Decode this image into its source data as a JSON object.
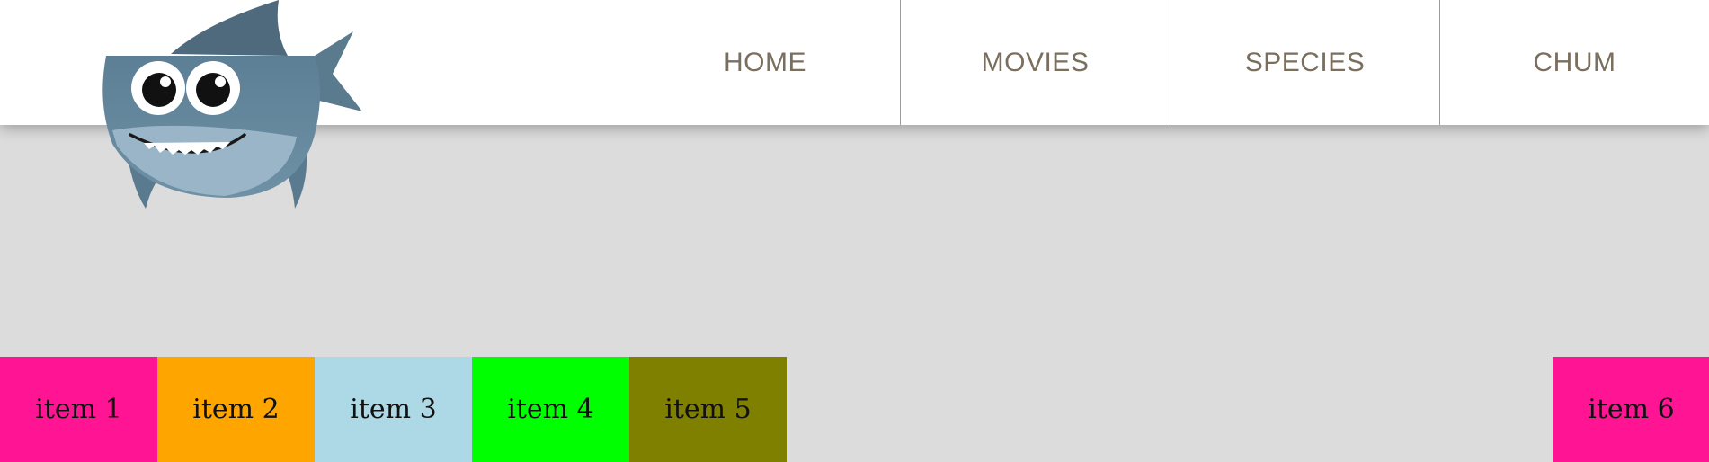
{
  "nav": {
    "items": [
      {
        "label": "HOME"
      },
      {
        "label": "MOVIES"
      },
      {
        "label": "SPECIES"
      },
      {
        "label": "CHUM"
      }
    ]
  },
  "logo": {
    "icon": "shark-icon",
    "colors": {
      "body": "#6a8ba0",
      "fin": "#4f6a7c",
      "belly": "#9ab5c7"
    }
  },
  "items": [
    {
      "label": "item 1",
      "color": "#ff1493"
    },
    {
      "label": "item 2",
      "color": "#ffa500"
    },
    {
      "label": "item 3",
      "color": "#add8e6"
    },
    {
      "label": "item 4",
      "color": "#00ff00"
    },
    {
      "label": "item 5",
      "color": "#808000"
    },
    {
      "label": "item 6",
      "color": "#ff1493"
    }
  ],
  "colors": {
    "page_background": "#dcdcdc",
    "header_background": "#ffffff",
    "nav_text": "#7a6e5f",
    "nav_divider": "#a89a86"
  }
}
